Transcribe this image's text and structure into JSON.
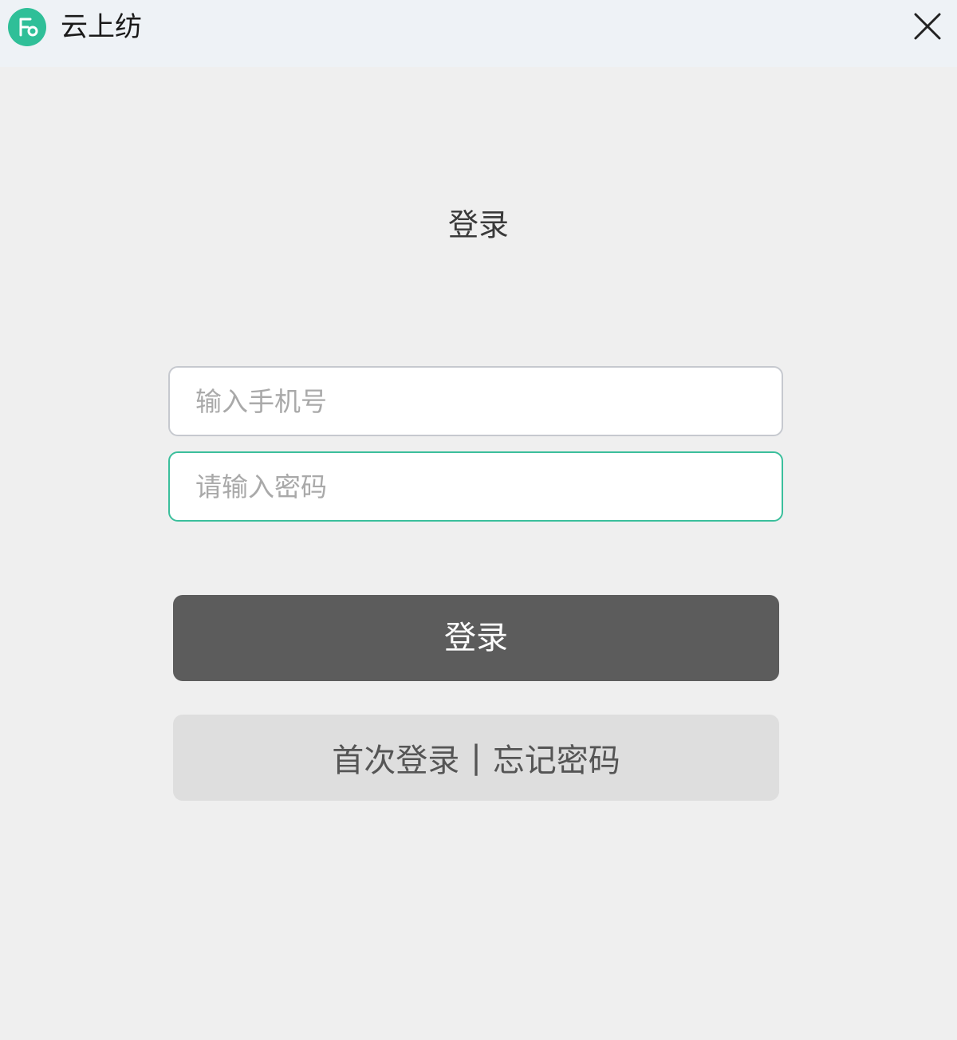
{
  "window": {
    "title": "云上纺",
    "app_icon": "app-logo-icon",
    "close_icon": "close-icon",
    "accent_color": "#2fbf98"
  },
  "login": {
    "heading": "登录",
    "phone_placeholder": "输入手机号",
    "password_placeholder": "请输入密码",
    "submit_label": "登录",
    "first_login_label": "首次登录",
    "separator": "|",
    "forgot_password_label": "忘记密码"
  }
}
